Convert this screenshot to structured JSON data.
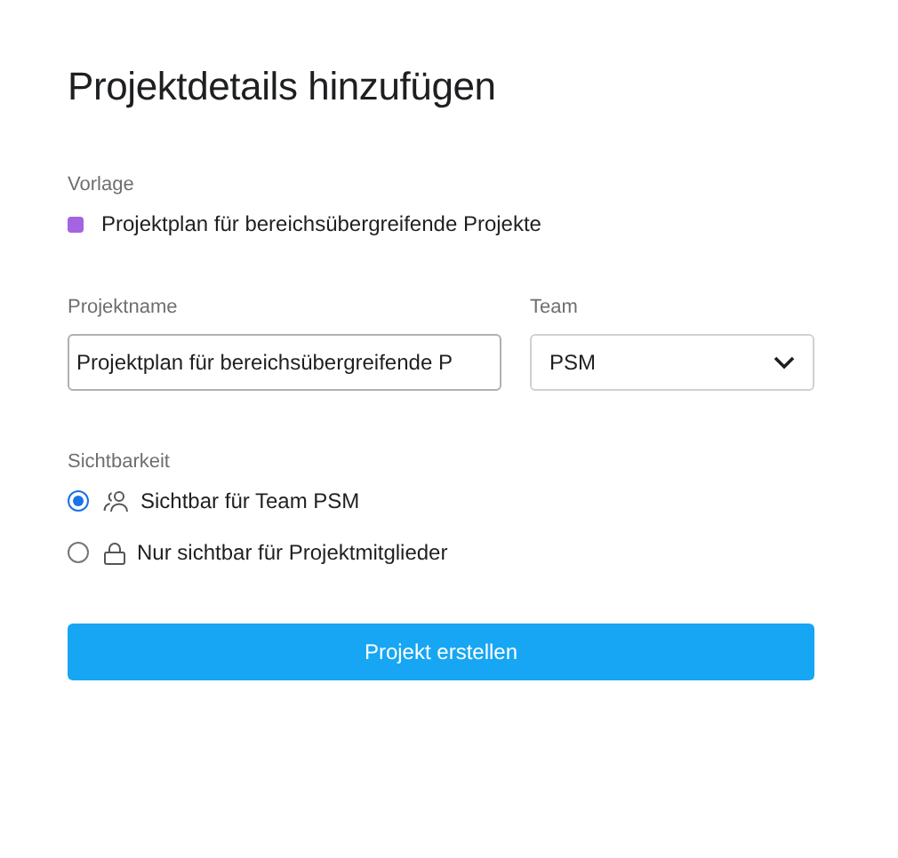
{
  "title": "Projektdetails hinzufügen",
  "template": {
    "label": "Vorlage",
    "name": "Projektplan für bereichsübergreifende Projekte",
    "color": "#a463e0"
  },
  "project_name": {
    "label": "Projektname",
    "value": "Projektplan für bereichsübergreifende P"
  },
  "team": {
    "label": "Team",
    "value": "PSM"
  },
  "visibility": {
    "label": "Sichtbarkeit",
    "options": [
      {
        "kind": "team",
        "label": "Sichtbar für Team PSM",
        "selected": true
      },
      {
        "kind": "lock",
        "label": "Nur sichtbar für Projektmitglieder",
        "selected": false
      }
    ]
  },
  "submit": "Projekt erstellen"
}
